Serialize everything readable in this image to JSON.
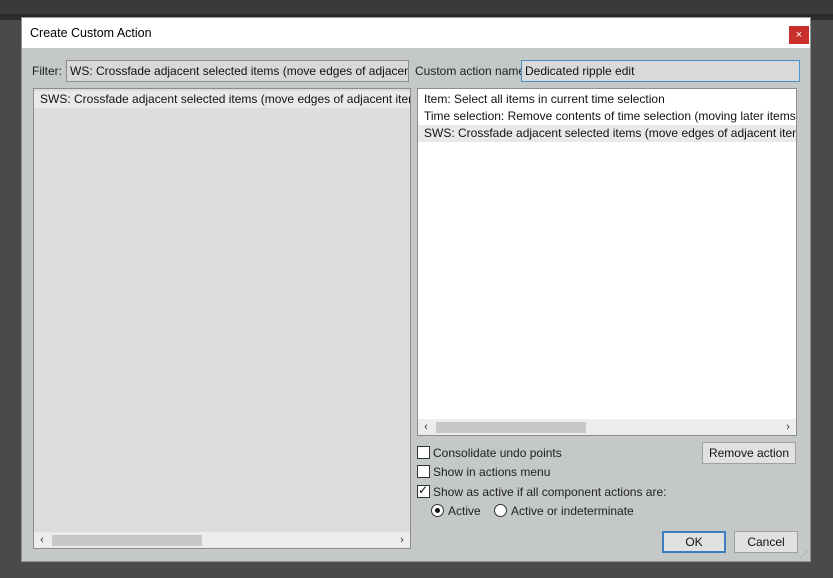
{
  "dialog": {
    "title": "Create Custom Action",
    "close_glyph": "×"
  },
  "filter": {
    "label": "Filter:",
    "value": "WS: Crossfade adjacent selected items (move edges of adjacent items)"
  },
  "custom_action": {
    "label": "Custom action name:",
    "value": "Dedicated ripple edit"
  },
  "available_actions": [
    "SWS: Crossfade adjacent selected items (move edges of adjacent items)"
  ],
  "component_actions": [
    "Item: Select all items in current time selection",
    "Time selection: Remove contents of time selection (moving later items)",
    "SWS: Crossfade adjacent selected items (move edges of adjacent items)"
  ],
  "scroll": {
    "left": "‹",
    "right": "›"
  },
  "options": {
    "consolidate": "Consolidate undo points",
    "show_menu": "Show in actions menu",
    "show_active": "Show as active if all component actions are:",
    "radio_active": "Active",
    "radio_indeterminate": "Active or indeterminate"
  },
  "state": {
    "consolidate_checked": false,
    "show_menu_checked": false,
    "show_active_checked": true,
    "radio_selected": "Active"
  },
  "buttons": {
    "remove": "Remove action",
    "ok": "OK",
    "cancel": "Cancel"
  },
  "colors": {
    "dialog_bg": "#c4c8c7",
    "close_button": "#c9302c",
    "focus_border": "#4a90c9"
  }
}
